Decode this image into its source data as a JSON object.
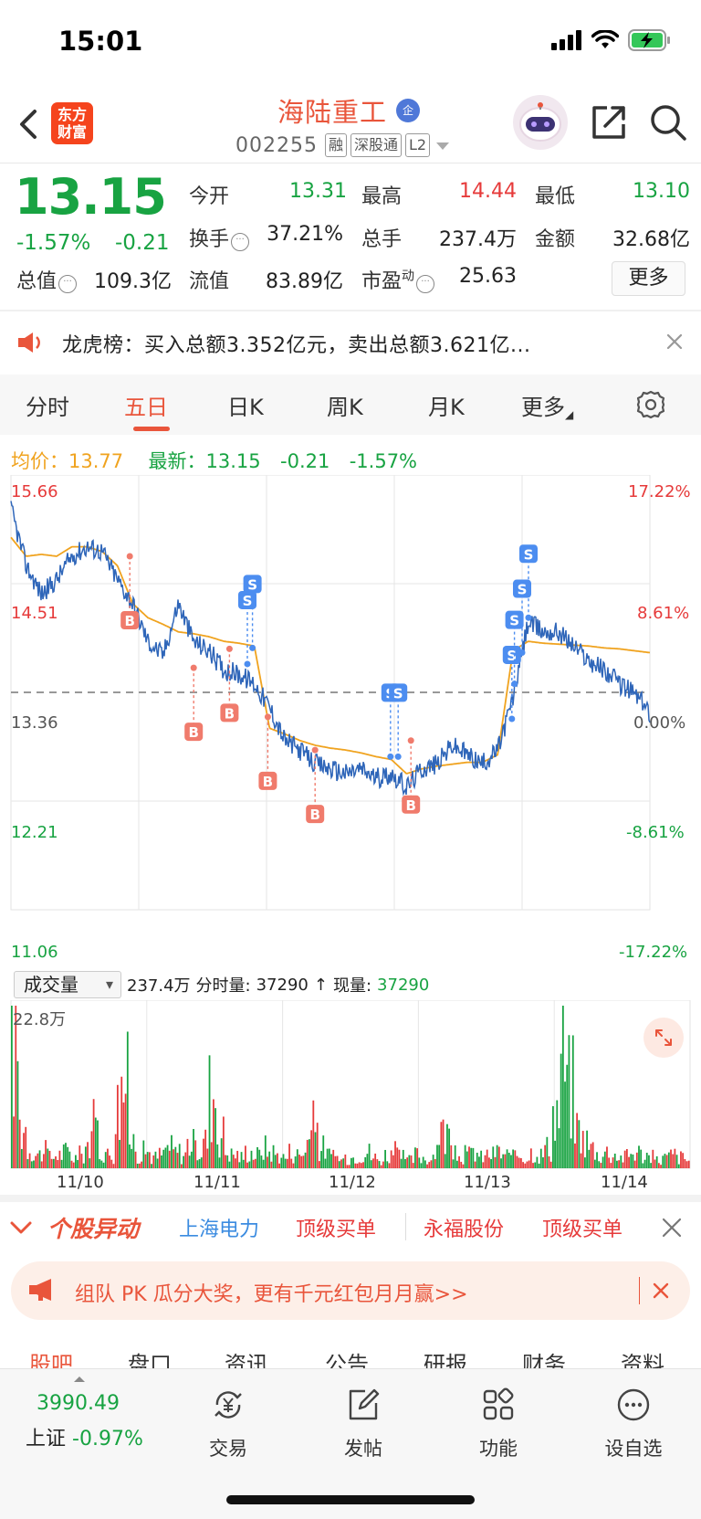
{
  "status_bar": {
    "time": "15:01"
  },
  "header": {
    "logo_line1": "东方",
    "logo_line2": "财富",
    "stock_name": "海陆重工",
    "qi_badge": "企",
    "stock_code": "002255",
    "tags": [
      "融",
      "深股通",
      "L2"
    ]
  },
  "quote": {
    "price": "13.15",
    "pct_change": "-1.57%",
    "change": "-0.21",
    "fields": {
      "open_label": "今开",
      "open": "13.31",
      "high_label": "最高",
      "high": "14.44",
      "low_label": "最低",
      "low": "13.10",
      "turnover_label": "换手",
      "turnover": "37.21%",
      "volume_label": "总手",
      "volume": "237.4万",
      "amount_label": "金额",
      "amount": "32.68亿",
      "mktcap_label": "总值",
      "mktcap": "109.3亿",
      "float_label": "流值",
      "float_cap": "83.89亿",
      "pe_label": "市盈",
      "pe_sup": "动",
      "pe": "25.63"
    },
    "more_label": "更多"
  },
  "notice": {
    "text": "龙虎榜：买入总额3.352亿元，卖出总额3.621亿..."
  },
  "tabs": [
    {
      "label": "分时",
      "active": false
    },
    {
      "label": "五日",
      "active": true
    },
    {
      "label": "日K",
      "active": false
    },
    {
      "label": "周K",
      "active": false
    },
    {
      "label": "月K",
      "active": false
    },
    {
      "label": "更多",
      "active": false
    }
  ],
  "avg_row": {
    "avg_label": "均价：",
    "avg_value": "13.77",
    "latest_label": "最新：",
    "latest_value": "13.15",
    "latest_change": "-0.21",
    "latest_pct": "-1.57%"
  },
  "chart_data": {
    "type": "line",
    "title": "",
    "y_left_ticks": [
      "15.66",
      "14.51",
      "13.36",
      "12.21",
      "11.06"
    ],
    "y_right_ticks": [
      "17.22%",
      "8.61%",
      "0.00%",
      "-8.61%",
      "-17.22%"
    ],
    "ylim": [
      11.06,
      15.66
    ],
    "reference_price": 13.36,
    "x_categories": [
      "11/10",
      "11/11",
      "11/12",
      "11/13",
      "11/14"
    ],
    "series": [
      {
        "name": "",
        "values": [
          15.3,
          14.7,
          14.4,
          14.55,
          14.8,
          14.9,
          14.85,
          14.55,
          14.3,
          13.9,
          13.75,
          14.3,
          13.9,
          13.8,
          13.6,
          13.55,
          13.45,
          13.2,
          12.85,
          12.75,
          12.6,
          12.55,
          12.5,
          12.55,
          12.45,
          12.5,
          12.35,
          12.55,
          12.6,
          12.8,
          12.7,
          12.6,
          12.75,
          13.3,
          14.1,
          14.0,
          14.0,
          13.85,
          13.7,
          13.6,
          13.45,
          13.35,
          13.15
        ]
      },
      {
        "name": "",
        "values": [
          15.0,
          14.8,
          14.82,
          14.8,
          14.9,
          14.9,
          14.85,
          14.7,
          14.3,
          14.15,
          14.08,
          14.0,
          13.98,
          13.95,
          13.9,
          13.88,
          13.85,
          12.98,
          12.92,
          12.85,
          12.8,
          12.77,
          12.75,
          12.72,
          12.68,
          12.65,
          12.5,
          12.55,
          12.58,
          12.6,
          12.62,
          12.62,
          12.7,
          13.8,
          13.9,
          13.88,
          13.87,
          13.86,
          13.85,
          13.83,
          13.82,
          13.8,
          13.78
        ]
      }
    ],
    "markers_buy": [
      {
        "day": 0.93,
        "price": 14.8,
        "label": "B"
      },
      {
        "day": 1.43,
        "price": 13.62,
        "label": "B"
      },
      {
        "day": 1.71,
        "price": 13.82,
        "label": "B"
      },
      {
        "day": 2.01,
        "price": 13.1,
        "label": "B"
      },
      {
        "day": 2.38,
        "price": 12.75,
        "label": "B"
      },
      {
        "day": 3.13,
        "price": 12.85,
        "label": "B"
      }
    ],
    "markers_sell": [
      {
        "day": 1.85,
        "price": 13.66,
        "label": "S"
      },
      {
        "day": 1.89,
        "price": 13.83,
        "label": "S"
      },
      {
        "day": 2.97,
        "price": 12.68,
        "label": "S"
      },
      {
        "day": 3.03,
        "price": 12.68,
        "label": "S"
      },
      {
        "day": 3.92,
        "price": 13.08,
        "label": "S"
      },
      {
        "day": 3.94,
        "price": 13.45,
        "label": "S"
      },
      {
        "day": 4.0,
        "price": 13.78,
        "label": "S"
      },
      {
        "day": 4.05,
        "price": 14.15,
        "label": "S"
      }
    ],
    "volume_max_label": "22.8万",
    "volume_profile": [
      0.95,
      0.3,
      0.15,
      0.1,
      0.12,
      0.08,
      0.1,
      0.12,
      0.08,
      0.1,
      0.18,
      0.3,
      0.12,
      0.1,
      0.45,
      0.6,
      0.2,
      0.1,
      0.12,
      0.08,
      0.1,
      0.15,
      0.12,
      0.1,
      0.18,
      0.12,
      0.2,
      0.55,
      0.25,
      0.12,
      0.1,
      0.08,
      0.12,
      0.1,
      0.15,
      0.12,
      0.1,
      0.08,
      0.12,
      0.1,
      0.2,
      0.3,
      0.15,
      0.1,
      0.08,
      0.06,
      0.08,
      0.1,
      0.12,
      0.08,
      0.06,
      0.1,
      0.12,
      0.08,
      0.06,
      0.1,
      0.08,
      0.06,
      0.3,
      0.25,
      0.1,
      0.08,
      0.1,
      0.12,
      0.08,
      0.1,
      0.12,
      0.1,
      0.08,
      0.1,
      0.08,
      0.12,
      0.1,
      0.15,
      0.4,
      0.8,
      0.6,
      0.3,
      0.2,
      0.15,
      0.1,
      0.12,
      0.1,
      0.08,
      0.1,
      0.12,
      0.1,
      0.08,
      0.06,
      0.08,
      0.1,
      0.08,
      0.06,
      0.15
    ]
  },
  "volume_bar": {
    "select_label": "成交量",
    "total": "237.4万",
    "tick_label": "分时量:",
    "tick_value": "37290",
    "arrow": "↑",
    "now_label": "现量:",
    "now_value": "37290"
  },
  "alert_bar": {
    "title": "个股异动",
    "items": [
      {
        "text": "上海电力",
        "color": "#3b8be0"
      },
      {
        "text": "顶级买单",
        "color": "#e63a3a"
      },
      {
        "text": "永福股份",
        "color": "#e63a3a"
      },
      {
        "text": "顶级买单",
        "color": "#e63a3a"
      }
    ]
  },
  "promo": {
    "text": "组队 PK 瓜分大奖，更有千元红包月月赢>>"
  },
  "sub_tabs": [
    "股吧",
    "盘口",
    "资讯",
    "公告",
    "研报",
    "财务",
    "资料"
  ],
  "bottom_bar": {
    "index_value": "3990.49",
    "index_name": "上证",
    "index_pct": "-0.97%",
    "items": [
      {
        "label": "交易",
        "icon": "yen-exchange-icon"
      },
      {
        "label": "发帖",
        "icon": "edit-icon"
      },
      {
        "label": "功能",
        "icon": "grid-icon"
      },
      {
        "label": "设自选",
        "icon": "more-dots-icon"
      }
    ]
  },
  "colors": {
    "up": "#e63a3a",
    "down": "#18a342",
    "accent": "#e9553b",
    "price_line": "#2f66b9",
    "avg_line": "#f0a31f"
  }
}
